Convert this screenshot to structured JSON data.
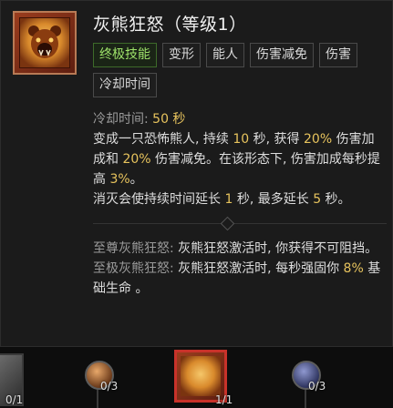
{
  "skill": {
    "title": "灰熊狂怒（等级1）",
    "icon": "bear-icon",
    "tags": [
      "终极技能",
      "变形",
      "能人",
      "伤害减免",
      "伤害",
      "冷却时间"
    ]
  },
  "description": {
    "cooldown_label": "冷却时间:",
    "cooldown_value": "50 秒",
    "l1_a": "变成一只恐怖熊人, 持续 ",
    "l1_n1": "10",
    "l1_b": " 秒, 获得 ",
    "l1_n2": "20%",
    "l1_c": " 伤害加成和 ",
    "l1_n3": "20%",
    "l1_d": " 伤害减免。在该形态下, 伤害加成每秒提高 ",
    "l1_n4": "3%",
    "l1_e": "。",
    "l2_a": "消灭会使持续时间延长 ",
    "l2_n1": "1",
    "l2_b": " 秒, 最多延长 ",
    "l2_n2": "5",
    "l2_c": " 秒。"
  },
  "upgrades": {
    "supreme_label": "至尊灰熊狂怒:",
    "supreme_text": " 灰熊狂怒激活时, 你获得不可阻挡。",
    "prime_label": "至极灰熊狂怒:",
    "prime_text_a": " 灰熊狂怒激活时, 每秒强固你 ",
    "prime_num": "8%",
    "prime_text_b": " 基础生命 。"
  },
  "skill_tree": {
    "nodes": [
      {
        "name": "left-partial",
        "count": "0/1"
      },
      {
        "name": "upgrade-left",
        "count": "0/3"
      },
      {
        "name": "grizzly-rage",
        "count": "1/1"
      },
      {
        "name": "upgrade-right",
        "count": "0/3"
      }
    ]
  },
  "colors": {
    "highlight": "#e7c35d",
    "ultimate_tag": "#9ee26a",
    "selected_border": "#c8322a"
  }
}
